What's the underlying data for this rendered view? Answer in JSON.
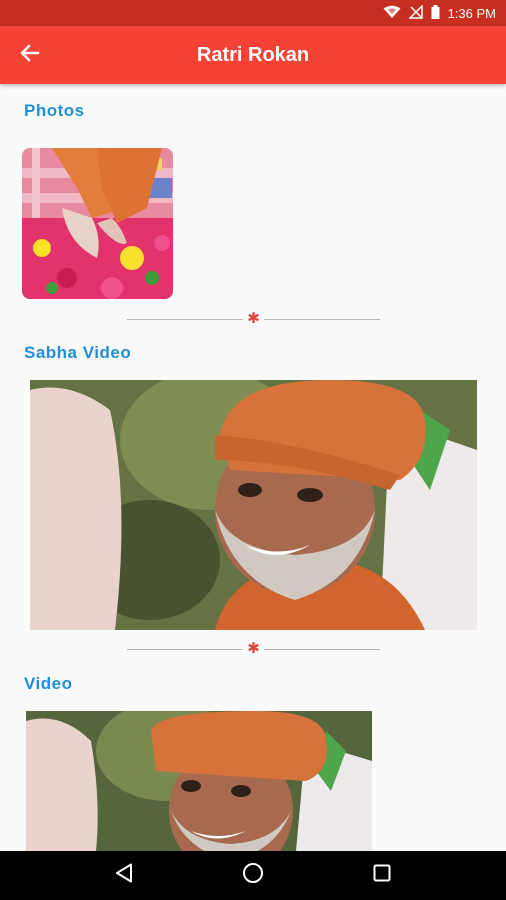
{
  "status_bar": {
    "time": "1:36 PM"
  },
  "app_bar": {
    "title": "Ratri Rokan"
  },
  "sections": {
    "photos": {
      "title": "Photos"
    },
    "sabha_video": {
      "title": "Sabha Video"
    },
    "video": {
      "title": "Video"
    }
  },
  "icons": {
    "back": "arrow-left-icon",
    "divider": "star-icon",
    "nav_back": "triangle-back-icon",
    "nav_home": "circle-home-icon",
    "nav_recents": "square-recents-icon"
  },
  "colors": {
    "app_bar": "#f44336",
    "status_bar": "#c62e22",
    "section_title": "#1f8fd6",
    "divider_star": "#e0453a"
  }
}
